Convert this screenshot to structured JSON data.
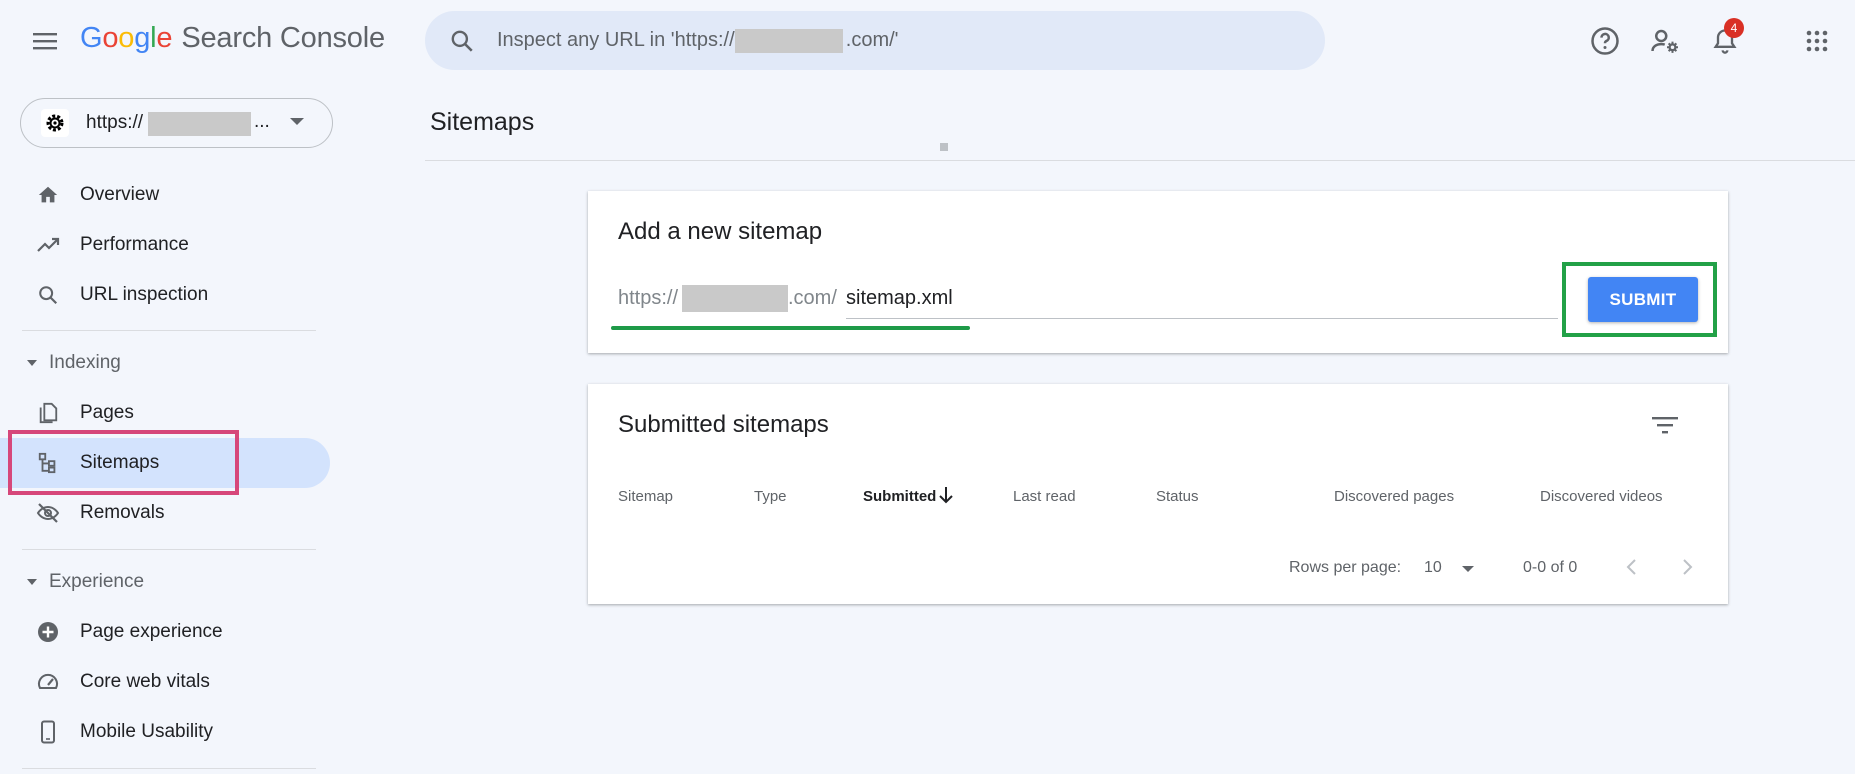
{
  "app": {
    "logo_letters": [
      "G",
      "o",
      "o",
      "g",
      "l",
      "e"
    ],
    "product": "Search Console"
  },
  "search": {
    "placeholder": "Inspect any URL in 'https://                    .com/'"
  },
  "top_icons": {
    "help": "help-icon",
    "users": "manage-users-icon",
    "notifications": "bell-icon",
    "notifications_count": "4",
    "apps": "apps-grid-icon"
  },
  "property": {
    "prefix": "https://",
    "ellipsis": "..."
  },
  "sidebar": {
    "items": [
      {
        "label": "Overview",
        "icon": "home-icon"
      },
      {
        "label": "Performance",
        "icon": "trending-icon"
      },
      {
        "label": "URL inspection",
        "icon": "search-icon"
      }
    ],
    "indexing": {
      "label": "Indexing",
      "items": [
        {
          "label": "Pages",
          "icon": "pages-icon"
        },
        {
          "label": "Sitemaps",
          "icon": "sitemap-icon",
          "active": true
        },
        {
          "label": "Removals",
          "icon": "eye-off-icon"
        }
      ]
    },
    "experience": {
      "label": "Experience",
      "items": [
        {
          "label": "Page experience",
          "icon": "plus-circle-icon"
        },
        {
          "label": "Core web vitals",
          "icon": "gauge-icon"
        },
        {
          "label": "Mobile Usability",
          "icon": "phone-icon"
        }
      ]
    }
  },
  "main": {
    "title": "Sitemaps",
    "add_card": {
      "title": "Add a new sitemap",
      "prefix": "https://",
      "suffix": ".com/",
      "input_value": "sitemap.xml",
      "submit_label": "SUBMIT"
    },
    "submitted_card": {
      "title": "Submitted sitemaps",
      "columns": [
        "Sitemap",
        "Type",
        "Submitted",
        "Last read",
        "Status",
        "Discovered pages",
        "Discovered videos"
      ],
      "sorted_column": "Submitted",
      "rows_per_page_label": "Rows per page:",
      "rows_per_page_value": "10",
      "range_text": "0-0 of 0"
    }
  },
  "colors": {
    "accent": "#4285f4",
    "active_nav": "#d3e3fd",
    "highlight_pink": "#d6477a",
    "highlight_green": "#22a147"
  }
}
